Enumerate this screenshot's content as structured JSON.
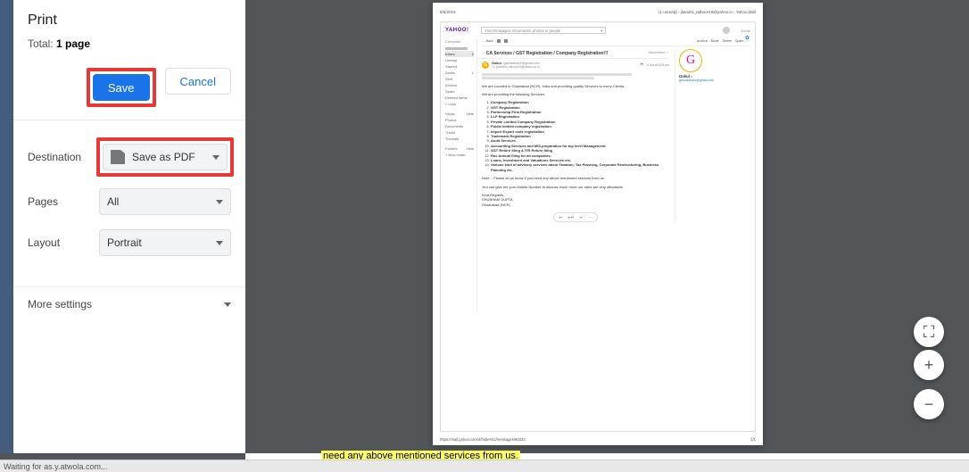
{
  "print_panel": {
    "title": "Print",
    "total_prefix": "Total:",
    "total_value": "1 page",
    "save_label": "Save",
    "cancel_label": "Cancel",
    "rows": {
      "destination_label": "Destination",
      "destination_value": "Save as PDF",
      "pages_label": "Pages",
      "pages_value": "All",
      "layout_label": "Layout",
      "layout_value": "Portrait"
    },
    "more_settings": "More settings"
  },
  "preview": {
    "header_left": "6/5/2019",
    "header_right": "(1 unread) - jitandra_rathore16@yahoo.in - Yahoo Mail",
    "footer_left": "https://mail.yahoo.com/d/folders/1/messages/60324",
    "footer_right": "1/1"
  },
  "yahoo": {
    "logo": "YAHOO!",
    "search_placeholder": "Find messages, documents, photos or people",
    "home": "Home",
    "compose": "Compose",
    "folders": {
      "inbox": "Inbox",
      "inbox_count": "1",
      "unread": "Unread",
      "starred": "Starred",
      "drafts": "Drafts",
      "drafts_count": "1",
      "sent": "Sent",
      "archive": "Archive",
      "spam": "Spam",
      "deleted": "Deleted Items",
      "less": "˄ Less",
      "views": "Views",
      "hide1": "Hide",
      "photos": "Photos",
      "documents": "Documents",
      "travel": "Travel",
      "tutorials": "Tutorials",
      "folders_hdr": "Folders",
      "hide2": "Hide",
      "newfolder": "+ New folder"
    },
    "toolbar": {
      "back": "← Back",
      "archive": "Archive",
      "move": "Move",
      "delete": "Delete",
      "spam": "Spam"
    },
    "msg": {
      "subject": "CA Services / GST Registration / Company Registration!!!",
      "tag": "Yahoo/Inbox",
      "sender_name": "Gokul",
      "sender_email": "<gkestservs01@gmail.com>",
      "date": "4 Jun at 6:54 pm",
      "to": "To: jitandra_rathore16@yahoo.co.in"
    },
    "profile": {
      "initial": "G",
      "name": "Gokul",
      "email": "gokulsolo51@gmail.com"
    },
    "body": {
      "intro": "We are Located in Ghaziabad (NCR), India and providing quality Services to every Clients.",
      "lead": "We are providing the following Services:",
      "items": {
        "1": "Company Registration",
        "2": "GST Registration",
        "3": "Partnership Firm Registration",
        "4": "LLP Registration",
        "5": "Private Limited Company Registration",
        "6": "Public limited company registration",
        "7": "Import Export code registration",
        "8": "Trademark Registration",
        "9": "Audit Services",
        "10": "Accounting Services and MIS preparation for top level Management.",
        "11": "GST Return filing & ITR Return filing",
        "12": "Roc Annual filing for all companies.",
        "13": "Loans, Investment and Valuations Services etc.",
        "14": "Various kind of advisory services about Taxation, Tax Planning, Corporate Restructuring, Business Planning etc."
      },
      "note": "Note: - Please let us know if you need any above mentioned services from us.",
      "call": "You can give me your Mobile Number to discuss much more our rates are very affordable.",
      "regards1": "Kind Regards,",
      "regards2": "SHUBHAM GUPTA",
      "regards3": "Ghaziabad (NCR)"
    }
  },
  "fab": {
    "fit": "⛶",
    "plus": "+",
    "minus": "−"
  },
  "status_bar": "Waiting for as.y.atwola.com...",
  "bottom_text": "need any above mentioned services from us."
}
